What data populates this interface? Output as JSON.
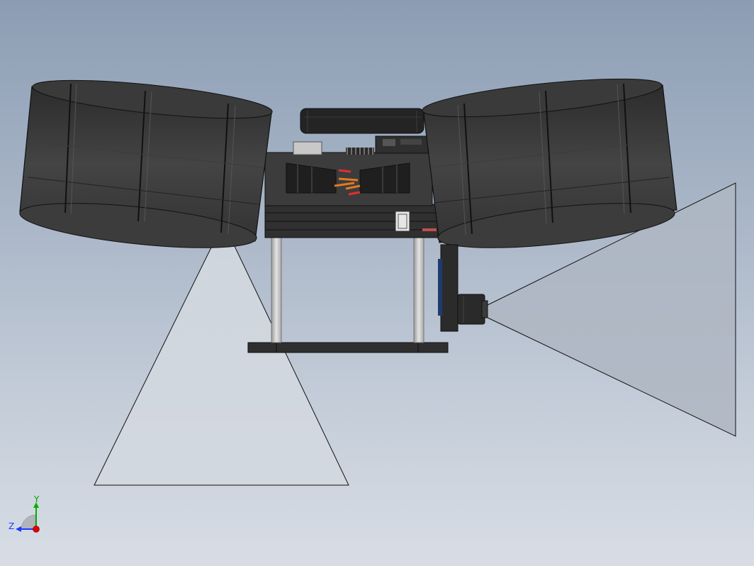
{
  "triad": {
    "y_label": "Y",
    "z_label": "Z",
    "y_color": "#00b000",
    "z_color": "#1a3cff",
    "x_color": "#e00000"
  },
  "colors": {
    "background_top": "#8c9db3",
    "background_bottom": "#d8dde5",
    "part_dark": "#3a3a3a",
    "part_edge": "#111111",
    "sensor_cone": "#d0d5dd"
  }
}
